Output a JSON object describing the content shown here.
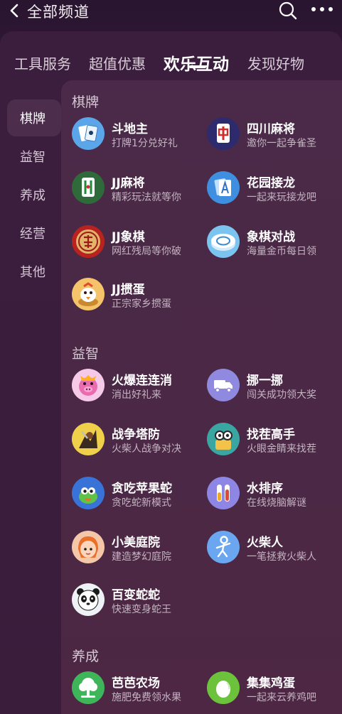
{
  "header": {
    "title": "全部频道"
  },
  "tabs": [
    {
      "label": "工具服务"
    },
    {
      "label": "超值优惠"
    },
    {
      "label": "欢乐互动"
    },
    {
      "label": "发现好物"
    }
  ],
  "sidenav": [
    {
      "label": "棋牌"
    },
    {
      "label": "益智"
    },
    {
      "label": "养成"
    },
    {
      "label": "经营"
    },
    {
      "label": "其他"
    }
  ],
  "sections": {
    "chess": {
      "title": "棋牌",
      "items": [
        {
          "name": "斗地主",
          "desc": "打牌1分兑好礼",
          "icon": "poker-cards-icon"
        },
        {
          "name": "四川麻将",
          "desc": "邀你一起争雀圣",
          "icon": "mahjong-zhong-icon"
        },
        {
          "name": "JJ麻将",
          "desc": "精彩玩法就等你",
          "icon": "mahjong-bamboo-icon"
        },
        {
          "name": "花园接龙",
          "desc": "一起来玩接龙吧",
          "icon": "solitaire-card-icon"
        },
        {
          "name": "JJ象棋",
          "desc": "网红残局等你破",
          "icon": "xiangqi-shuai-icon"
        },
        {
          "name": "象棋对战",
          "desc": "海量金币每日领",
          "icon": "xiangqi-piece-icon"
        },
        {
          "name": "JJ掼蛋",
          "desc": "正宗家乡掼蛋",
          "icon": "guandan-bird-icon"
        }
      ]
    },
    "puzzle": {
      "title": "益智",
      "items": [
        {
          "name": "火爆连连消",
          "desc": "消出好礼来",
          "icon": "pig-icon"
        },
        {
          "name": "挪一挪",
          "desc": "闯关成功领大奖",
          "icon": "truck-icon"
        },
        {
          "name": "战争塔防",
          "desc": "火柴人战争对决",
          "icon": "warrior-icon"
        },
        {
          "name": "找茬高手",
          "desc": "火眼金睛来找茬",
          "icon": "magnifier-face-icon"
        },
        {
          "name": "贪吃苹果蛇",
          "desc": "贪吃蛇新模式",
          "icon": "snake-icon"
        },
        {
          "name": "水排序",
          "desc": "在线烧脑解谜",
          "icon": "water-tubes-icon"
        },
        {
          "name": "小美庭院",
          "desc": "建造梦幻庭院",
          "icon": "girl-face-icon"
        },
        {
          "name": "火柴人",
          "desc": "一笔拯救火柴人",
          "icon": "stickman-icon"
        },
        {
          "name": "百变蛇蛇",
          "desc": "快速变身蛇王",
          "icon": "panda-icon"
        }
      ]
    },
    "raise": {
      "title": "养成",
      "items": [
        {
          "name": "芭芭农场",
          "desc": "施肥免费领水果",
          "icon": "farm-tree-icon"
        },
        {
          "name": "集集鸡蛋",
          "desc": "一起来云养鸡吧",
          "icon": "egg-icon"
        }
      ]
    }
  },
  "colors": {
    "bg": "#2a1530",
    "panel": "#4a2a48",
    "accent": "#ffffff"
  }
}
